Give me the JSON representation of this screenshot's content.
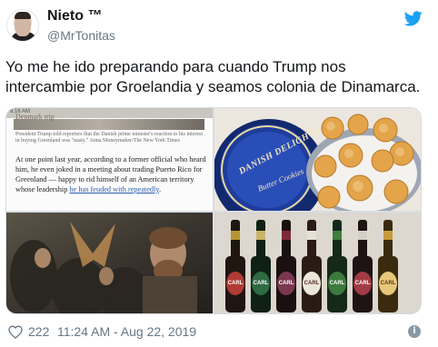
{
  "author": {
    "display_name": "Nieto ™",
    "handle": "@MrTonitas",
    "avatar_icon": "avatar-photo",
    "platform_icon": "twitter-bird-icon",
    "brand_color": "#1da1f2"
  },
  "tweet": {
    "text": "Yo me he ido preparando para cuando Trump nos intercambie por Groelandia y seamos colonia de Dinamarca."
  },
  "media": {
    "article": {
      "status_bar": "8:16 AM",
      "kicker": "Denmark trip",
      "caption": "President Trump told reporters that the Danish prime minister's reaction to his interest in buying Greenland was \"nasty.\" Anna Moneymaker/The New York Times",
      "body_prefix": "At one point last year, according to a former official who heard him, he even joked in a meeting about trading Puerto Rico for Greenland — happy to rid himself of an American territory whose leadership ",
      "body_link": "he has feuded with repeatedly",
      "body_suffix": "."
    },
    "cookies": {
      "title": "DANISH DELIGHTS",
      "subtitle": "Butter Cookies"
    },
    "beers": {
      "label": "CARL"
    }
  },
  "footer": {
    "like_icon": "heart-icon",
    "like_count": "222",
    "timestamp": "11:24 AM - Aug 22, 2019",
    "info_icon": "info-icon",
    "info_glyph": "i"
  }
}
